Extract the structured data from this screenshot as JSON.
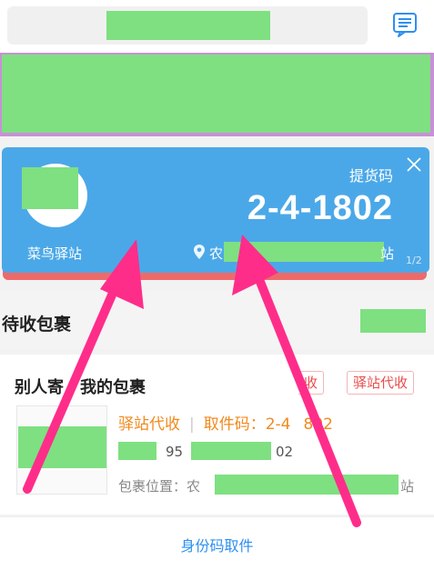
{
  "card": {
    "code_caption": "提货码",
    "pickup_code": "2-4-1802",
    "station_name": "菜鸟驿站",
    "address_prefix": "农",
    "address_suffix": "站",
    "page_indicator": "1/2"
  },
  "section": {
    "title": "待收包裹"
  },
  "package": {
    "title_part1": "别人寄",
    "title_part2": "我的包裹",
    "tag_collect": "收",
    "tag_station": "驿站代收",
    "status": "驿站代收",
    "code_label": "取件码：2-4",
    "code_suffix": "802",
    "tracking_prefix": "95",
    "tracking_suffix": "02",
    "location_label": "包裹位置：农",
    "location_suffix": "站"
  },
  "bottom": {
    "link": "身份码取件"
  },
  "colors": {
    "card_blue": "#4ba8e8",
    "accent_orange": "#f08a1e",
    "tag_red": "#e94c4c",
    "link_blue": "#2d8ff0",
    "arrow_pink": "#ff2d8a",
    "redaction_green": "#7ee081"
  }
}
